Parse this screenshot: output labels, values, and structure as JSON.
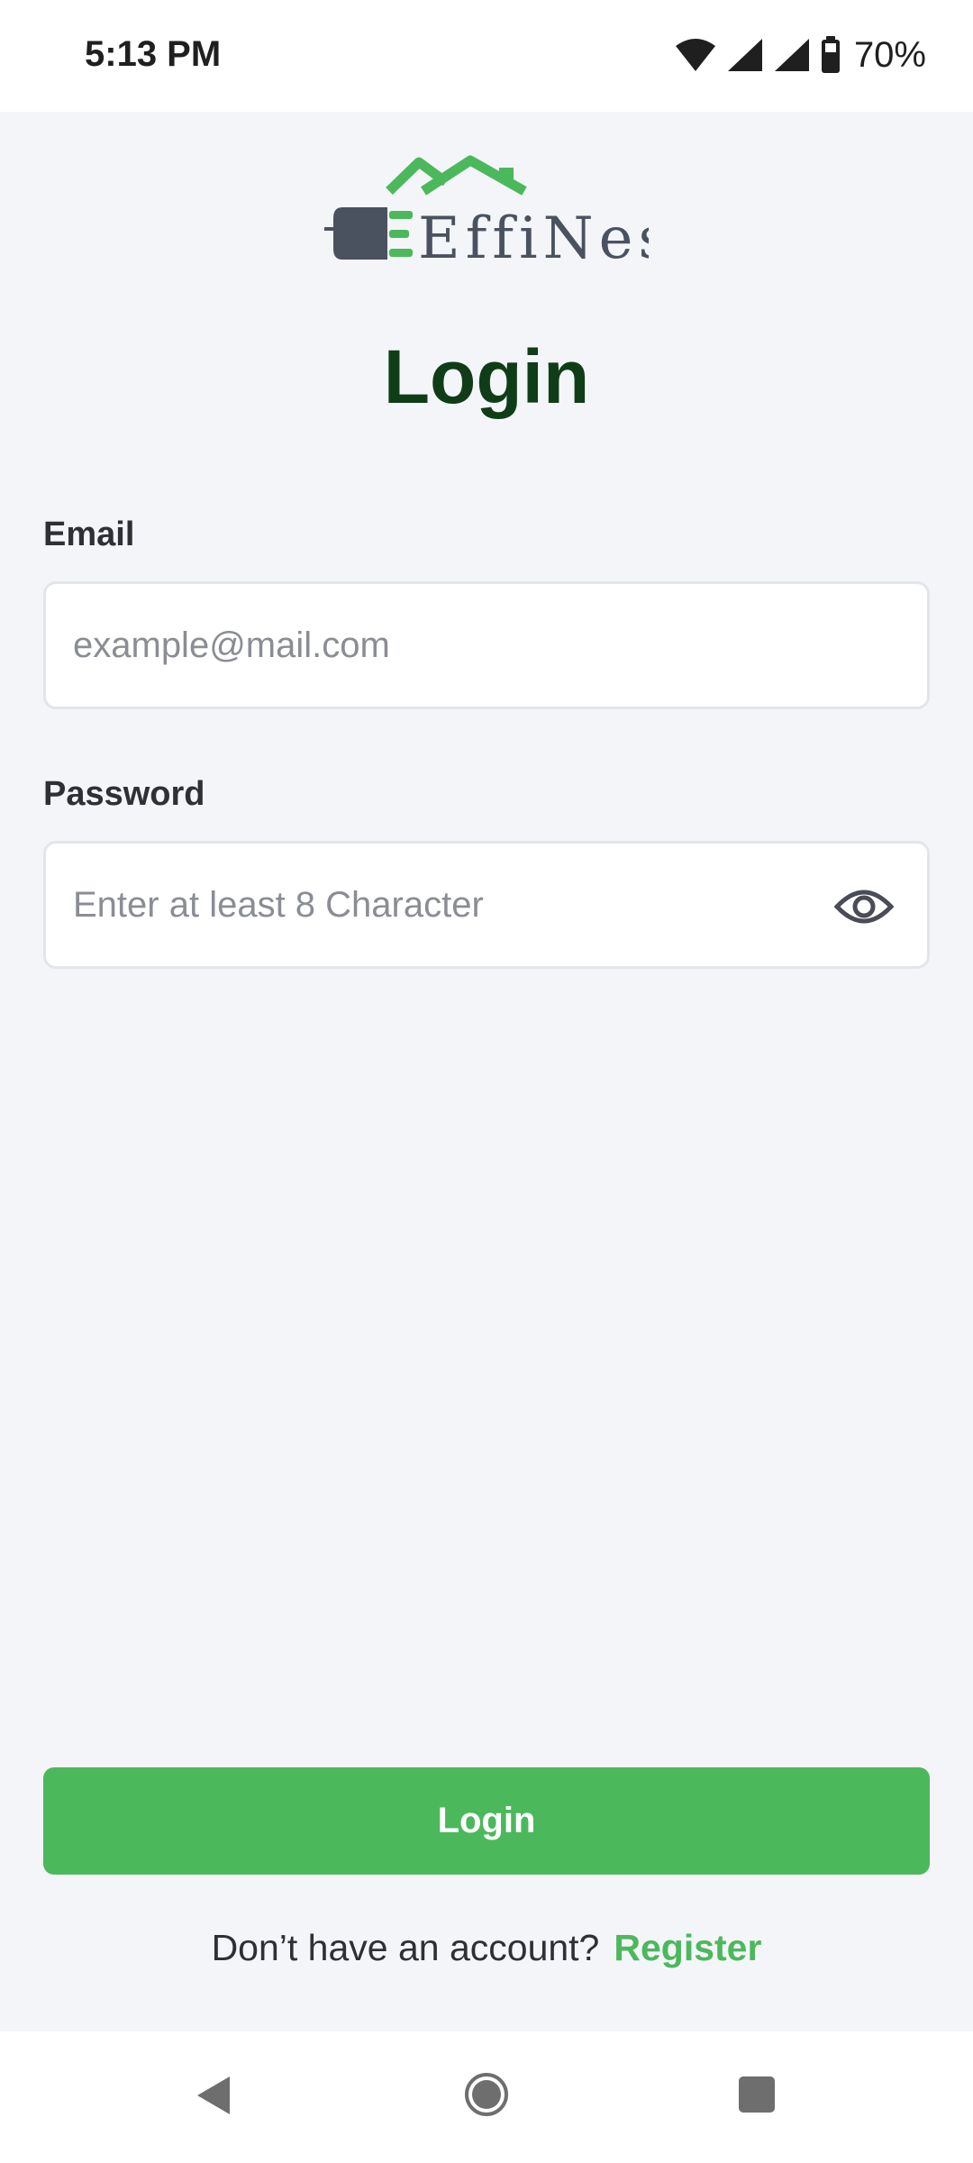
{
  "status_bar": {
    "time": "5:13 PM",
    "battery": "70%",
    "icons": [
      "wifi-icon",
      "cell-signal-icon",
      "cell-signal-icon",
      "battery-icon"
    ]
  },
  "logo": {
    "text": "EffiNest",
    "colors": {
      "green": "#4cb85c",
      "slate": "#4a5260"
    }
  },
  "page": {
    "title": "Login"
  },
  "form": {
    "email_label": "Email",
    "email_placeholder": "example@mail.com",
    "email_value": "",
    "password_label": "Password",
    "password_placeholder": "Enter at least 8 Character",
    "password_value": "",
    "password_toggle_icon": "eye-icon"
  },
  "actions": {
    "login_label": "Login",
    "register_prompt": "Don’t have an account?",
    "register_link": "Register"
  },
  "nav": {
    "icons": [
      "back-icon",
      "home-icon",
      "recents-icon"
    ]
  },
  "colors": {
    "accent": "#4cb85c",
    "title": "#0f3d17",
    "background": "#f4f5f9"
  }
}
